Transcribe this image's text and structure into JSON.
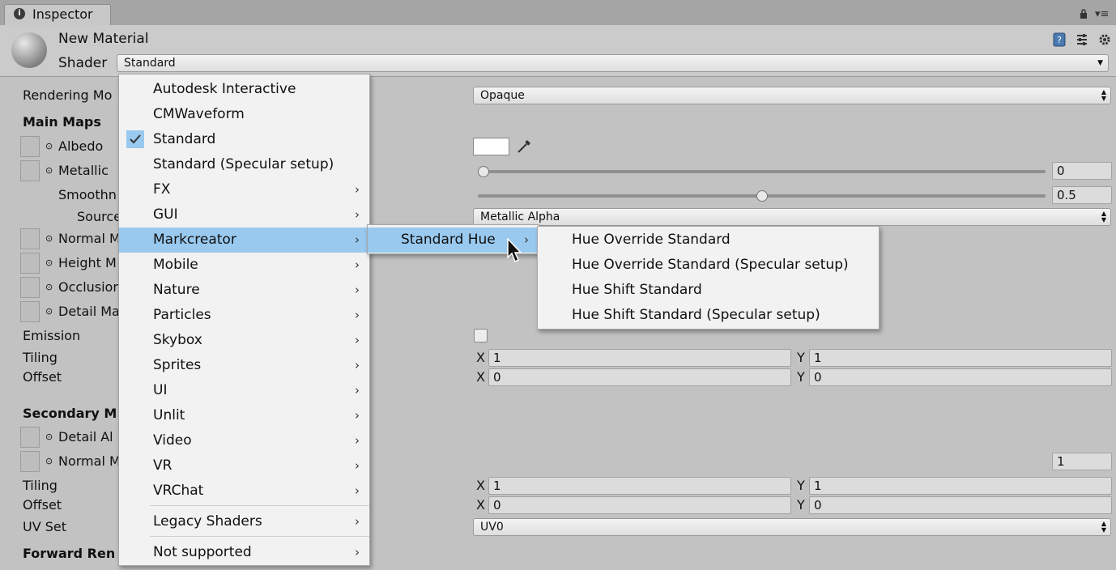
{
  "tab": {
    "title": "Inspector"
  },
  "header": {
    "material_name": "New Material",
    "shader_label": "Shader",
    "shader_value": "Standard"
  },
  "props": {
    "rendering_mode_label": "Rendering Mo",
    "rendering_mode_value": "Opaque",
    "main_maps": "Main Maps",
    "albedo": "Albedo",
    "metallic": "Metallic",
    "metallic_value": "0",
    "metallic_slider": 0,
    "smoothness": "Smoothn",
    "smoothness_value": "0.5",
    "smoothness_slider": 0.5,
    "source": "Source",
    "source_value": "Metallic Alpha",
    "normal": "Normal M",
    "height": "Height M",
    "occlusion": "Occlusion",
    "detail_mask": "Detail Ma",
    "emission": "Emission",
    "tiling": "Tiling",
    "offset": "Offset",
    "tiling_x": "1",
    "tiling_y": "1",
    "offset_x": "0",
    "offset_y": "0",
    "secondary_maps": "Secondary M",
    "detail_albedo": "Detail Al",
    "normal2": "Normal M",
    "normal2_value": "1",
    "tiling2": "Tiling",
    "offset2": "Offset",
    "tiling2_x": "1",
    "tiling2_y": "1",
    "offset2_x": "0",
    "offset2_y": "0",
    "uvset": "UV Set",
    "uvset_value": "UV0",
    "forward": "Forward Ren",
    "x": "X",
    "y": "Y"
  },
  "menu": {
    "items": [
      "Autodesk Interactive",
      "CMWaveform",
      "Standard",
      "Standard (Specular setup)",
      "FX",
      "GUI",
      "Markcreator",
      "Mobile",
      "Nature",
      "Particles",
      "Skybox",
      "Sprites",
      "UI",
      "Unlit",
      "Video",
      "VR",
      "VRChat",
      "Legacy Shaders",
      "Not supported"
    ],
    "submenu_item": "Standard Hue",
    "subsubmenu": [
      "Hue Override Standard",
      "Hue Override Standard (Specular setup)",
      "Hue Shift Standard",
      "Hue Shift Standard (Specular setup)"
    ]
  },
  "colors": {
    "highlight": "#99c9ef",
    "menu_bg": "#f2f2f2",
    "panel_bg": "#c2c2c2"
  }
}
